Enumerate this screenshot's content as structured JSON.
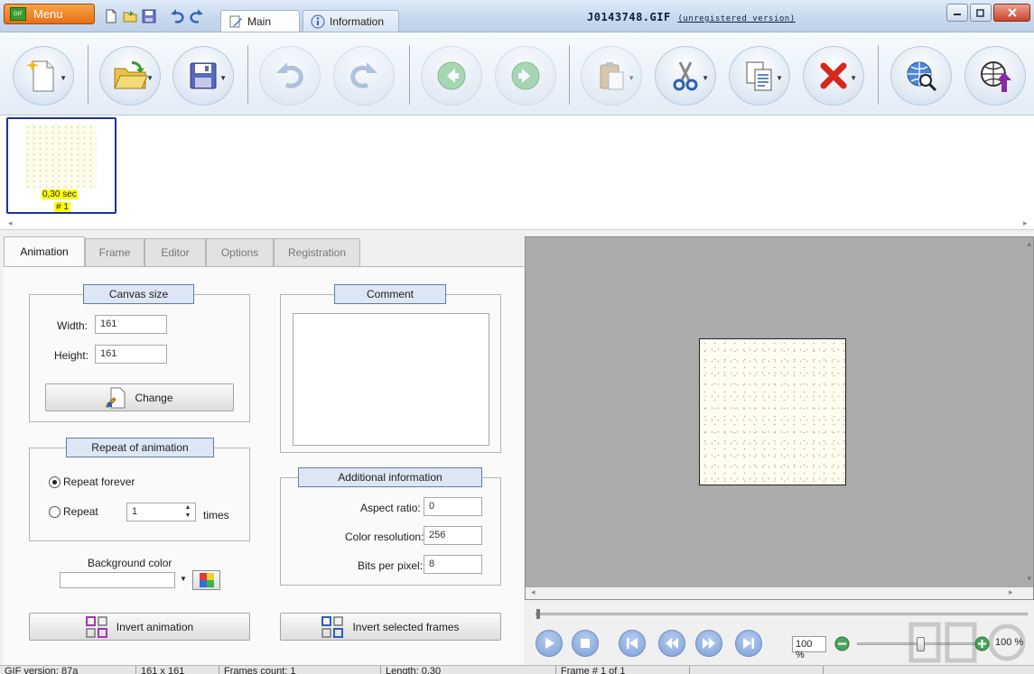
{
  "titlebar": {
    "menu_label": "Menu",
    "logo_text": "GIF",
    "tabs": [
      {
        "label": "Main",
        "active": true
      },
      {
        "label": "Information",
        "active": false
      }
    ],
    "document_name": "J0143748.GIF",
    "version_note": "(unregistered version)"
  },
  "ribbon": {
    "buttons": [
      {
        "name": "new-icon",
        "has_dropdown": true,
        "enabled": true
      },
      {
        "name": "open-folder-icon",
        "has_dropdown": true,
        "enabled": true
      },
      {
        "name": "save-icon",
        "has_dropdown": true,
        "enabled": true
      },
      {
        "name": "undo-icon",
        "has_dropdown": false,
        "enabled": false
      },
      {
        "name": "redo-icon",
        "has_dropdown": false,
        "enabled": false
      },
      {
        "name": "previous-frame-icon",
        "has_dropdown": false,
        "enabled": false
      },
      {
        "name": "next-frame-icon",
        "has_dropdown": false,
        "enabled": false
      },
      {
        "name": "paste-icon",
        "has_dropdown": true,
        "enabled": false
      },
      {
        "name": "cut-icon",
        "has_dropdown": true,
        "enabled": true
      },
      {
        "name": "copy-icon",
        "has_dropdown": true,
        "enabled": true
      },
      {
        "name": "delete-icon",
        "has_dropdown": true,
        "enabled": true
      },
      {
        "name": "web-search-icon",
        "has_dropdown": false,
        "enabled": true
      },
      {
        "name": "web-upload-icon",
        "has_dropdown": false,
        "enabled": true
      }
    ]
  },
  "frames": [
    {
      "time": "0,30 sec",
      "number": "# 1",
      "selected": true
    }
  ],
  "panel_tabs": [
    {
      "label": "Animation",
      "active": true
    },
    {
      "label": "Frame",
      "active": false
    },
    {
      "label": "Editor",
      "active": false
    },
    {
      "label": "Options",
      "active": false
    },
    {
      "label": "Registration",
      "active": false
    }
  ],
  "canvas_size": {
    "title": "Canvas size",
    "width_label": "Width:",
    "width_value": "161",
    "height_label": "Height:",
    "height_value": "161",
    "change_label": "Change"
  },
  "repeat": {
    "title": "Repeat of animation",
    "forever_label": "Repeat forever",
    "forever_selected": true,
    "repeat_label": "Repeat",
    "repeat_value": "1",
    "times_label": "times"
  },
  "background": {
    "label": "Background color",
    "value": ""
  },
  "comment": {
    "title": "Comment",
    "text": ""
  },
  "additional": {
    "title": "Additional information",
    "aspect_label": "Aspect ratio:",
    "aspect_value": "0",
    "color_res_label": "Color resolution:",
    "color_res_value": "256",
    "bpp_label": "Bits per pixel:",
    "bpp_value": "8"
  },
  "actions": {
    "invert_animation": "Invert animation",
    "invert_selected": "Invert selected frames"
  },
  "player": {
    "zoom_value": "100 %",
    "zoom_readout": "100 %",
    "zoom_level": 0.55
  },
  "status": {
    "version": "GIF version: 87a",
    "dimensions": "161 x 161",
    "frames_count": "Frames count: 1",
    "length": "Length: 0,30",
    "frame_pos": "Frame # 1 of 1"
  },
  "colors": {
    "accent": "#e86f12",
    "selection": "#1f2fa8",
    "highlight": "#ffff00",
    "group_header": "#dce6f4"
  }
}
